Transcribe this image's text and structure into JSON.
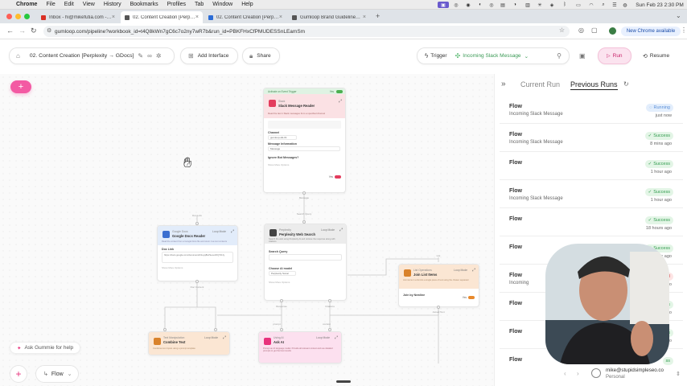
{
  "menubar": {
    "app": "Chrome",
    "items": [
      "File",
      "Edit",
      "View",
      "History",
      "Bookmarks",
      "Profiles",
      "Tab",
      "Window",
      "Help"
    ],
    "datetime": "Sun Feb 23  2:30 PM"
  },
  "tabs": [
    {
      "label": "Inbox - hi@mikefutia.com - M",
      "favicon_color": "#d93025",
      "active": false
    },
    {
      "label": "02. Content Creation [Perplexit",
      "favicon_color": "#555555",
      "active": true
    },
    {
      "label": "02. Content Creation [Perplexit",
      "favicon_color": "#2b6cd6",
      "active": false
    },
    {
      "label": "Gumloop Brand Guidelines fo",
      "favicon_color": "#555555",
      "active": false
    }
  ],
  "address": {
    "url": "gumloop.com/pipeline?workbook_id=t4Q8kWn7gC6c7o2ny7wR7b&run_id=PBKFHxCfPMUDESSnLEamSm",
    "new_chrome": "New Chrome available"
  },
  "toolbar": {
    "workflow_title": "02. Content Creation [Perplexity → GDocs]",
    "add_interface": "Add Interface",
    "share": "Share",
    "trigger": "Trigger",
    "incoming": "Incoming Slack Message",
    "run": "Run",
    "resume": "Resume",
    "accent": "#e8327c"
  },
  "canvas": {
    "nodes": {
      "slack": {
        "header": "Activate on Event Trigger",
        "top": "Slack",
        "title": "Slack Message Reader",
        "desc": "Read the last 1 Slack messages from a specified channel",
        "mode": "Yes",
        "channel_label": "Channel",
        "channel_value": "gumloop-slk-01",
        "msg_info_label": "Message Information",
        "msg_info_value": "Message",
        "ignore_label": "Ignore Bot Messages?",
        "ignore_value": "Yes",
        "show_more": "Show More Options",
        "out": "Message"
      },
      "gdocs": {
        "top": "Google Docs",
        "title": "Google Docs Reader",
        "mode": "Loop Mode",
        "desc": "Read the content from a Google Docs file and return it as text contents",
        "doc_label": "Doc Link",
        "doc_value": "https://docs.google.com/document/d/1oyq8HrSeoo4XQYDJy",
        "show_more": "Show More Options",
        "out": "Doc Content",
        "in": "Doc Link"
      },
      "perplexity": {
        "top": "Perplexity",
        "title": "Perplexity Web Search",
        "mode": "Loop Mode",
        "desc": "Search the web using Perplexity AI and retrieve the response along with citations",
        "query_label": "Search Query",
        "query_value": "",
        "model_label": "Choose AI model",
        "model_value": "Perplexity Sonar",
        "show_more": "Show More Options",
        "out1": "Response",
        "out2": "Citations",
        "in": "Search Query"
      },
      "join": {
        "top": "List Operations",
        "title": "Join List Items",
        "mode": "Loop Mode",
        "desc": "Join items in a list into a single piece of text using the chosen separator",
        "join_label": "Join by Newline",
        "join_value": "Yes",
        "in": "List",
        "out": "Joined Text"
      },
      "combine": {
        "top": "Text Manipulation",
        "title": "Combine Text",
        "mode": "Loop Mode",
        "desc": "Combines text inputs using a prompt template"
      },
      "askai": {
        "top": "Using AI",
        "title": "Ask AI",
        "mode": "Loop Mode",
        "desc": "Prompt an AI language model. Provide all relevant context and use detailed prompts to get the best results",
        "in1": "prompt",
        "in2": "context"
      }
    },
    "ask_gummie": "Ask Gummie for help",
    "flow": "Flow"
  },
  "panel": {
    "tab_current": "Current Run",
    "tab_previous": "Previous Runs",
    "runs": [
      {
        "title": "Flow",
        "sub": "Incoming Slack Message",
        "status": "Running",
        "time": "just now"
      },
      {
        "title": "Flow",
        "sub": "Incoming Slack Message",
        "status": "Success",
        "time": "8 mins ago"
      },
      {
        "title": "Flow",
        "sub": "",
        "status": "Success",
        "time": "1 hour ago"
      },
      {
        "title": "Flow",
        "sub": "Incoming Slack Message",
        "status": "Success",
        "time": "1 hour ago"
      },
      {
        "title": "Flow",
        "sub": "",
        "status": "Success",
        "time": "18 hours ago"
      },
      {
        "title": "Flow",
        "sub": "",
        "status": "Success",
        "time": "ys ago"
      },
      {
        "title": "Flow",
        "sub": "Incoming",
        "status": "ed",
        "time": "go"
      },
      {
        "title": "Flow",
        "sub": "",
        "status": "ss",
        "time": "go"
      },
      {
        "title": "Flow",
        "sub": "",
        "status": "ss",
        "time": "go"
      },
      {
        "title": "Flow",
        "sub": "",
        "status": "ss",
        "time": ""
      }
    ],
    "user_email": "mike@stupidsimpleseo.co",
    "user_plan": "Personal"
  }
}
